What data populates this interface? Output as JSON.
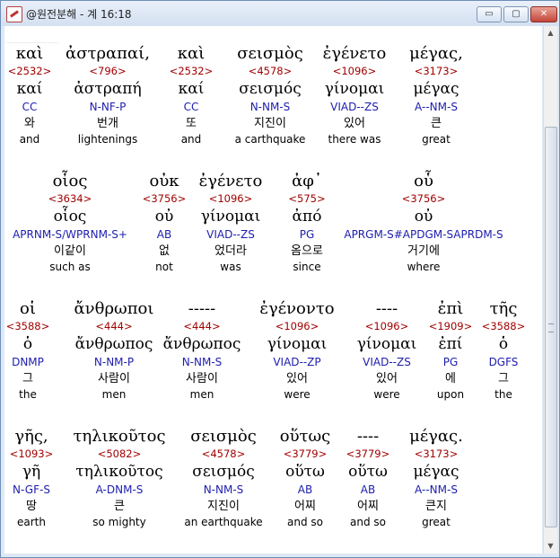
{
  "window": {
    "title": "@원전분해 - 계 16:18"
  },
  "buttons": {
    "minimize": "▭",
    "maximize": "▢",
    "close": "✕"
  },
  "lines": [
    {
      "words": [
        {
          "greek": "καὶ",
          "strong": "<2532>",
          "lemma": "καί",
          "morph": "CC",
          "korean": "와",
          "english": "and"
        },
        {
          "greek": "ἀστραπαί,",
          "strong": "<796>",
          "lemma": "ἀστραπή",
          "morph": "N-NF-P",
          "korean": "번개",
          "english": "lightenings"
        },
        {
          "greek": "καὶ",
          "strong": "<2532>",
          "lemma": "καί",
          "morph": "CC",
          "korean": "또",
          "english": "and"
        },
        {
          "greek": "σεισμὸς",
          "strong": "<4578>",
          "lemma": "σεισμός",
          "morph": "N-NM-S",
          "korean": "지진이",
          "english": "a carthquake"
        },
        {
          "greek": "ἐγένετο",
          "strong": "<1096>",
          "lemma": "γίνομαι",
          "morph": "VIAD--ZS",
          "korean": "있어",
          "english": "there was"
        },
        {
          "greek": "μέγας,",
          "strong": "<3173>",
          "lemma": "μέγας",
          "morph": "A--NM-S",
          "korean": "큰",
          "english": "great"
        }
      ]
    },
    {
      "words": [
        {
          "greek": "οἷος",
          "strong": "<3634>",
          "lemma": "οἷος",
          "morph": "APRNM-S/WPRNM-S+",
          "korean": "이같이",
          "english": "such as"
        },
        {
          "greek": "οὐκ",
          "strong": "<3756>",
          "lemma": "οὐ",
          "morph": "AB",
          "korean": "없",
          "english": "not"
        },
        {
          "greek": "ἐγένετο",
          "strong": "<1096>",
          "lemma": "γίνομαι",
          "morph": "VIAD--ZS",
          "korean": "었더라",
          "english": "was"
        },
        {
          "greek": "ἀφ᾽",
          "strong": "<575>",
          "lemma": "ἀπό",
          "morph": "PG",
          "korean": "옴으로",
          "english": "since"
        },
        {
          "greek": "οὗ",
          "strong": "<3756>",
          "lemma": "οὐ",
          "morph": "APRGM-S#APDGM-SAPRDM-S",
          "korean": "거기에",
          "english": "where"
        }
      ]
    },
    {
      "words": [
        {
          "greek": "οἱ",
          "strong": "<3588>",
          "lemma": "ὁ",
          "morph": "DNMP",
          "korean": "그",
          "english": "the"
        },
        {
          "greek": "ἄνθρωποι",
          "strong": "<444>",
          "lemma": "ἄνθρωπος",
          "morph": "N-NM-P",
          "korean": "사람이",
          "english": "men"
        },
        {
          "greek": "-----",
          "strong": "<444>",
          "lemma": "ἄνθρωπος",
          "morph": "N-NM-S",
          "korean": "사람이",
          "english": "men"
        },
        {
          "greek": "ἐγένοντο",
          "strong": "<1096>",
          "lemma": "γίνομαι",
          "morph": "VIAD--ZP",
          "korean": "있어",
          "english": "were"
        },
        {
          "greek": "----",
          "strong": "<1096>",
          "lemma": "γίνομαι",
          "morph": "VIAD--ZS",
          "korean": "있어",
          "english": "were"
        },
        {
          "greek": "ἐπὶ",
          "strong": "<1909>",
          "lemma": "ἐπί",
          "morph": "PG",
          "korean": "에",
          "english": "upon"
        },
        {
          "greek": "τῆς",
          "strong": "<3588>",
          "lemma": "ὁ",
          "morph": "DGFS",
          "korean": "그",
          "english": "the"
        }
      ]
    },
    {
      "words": [
        {
          "greek": "γῆς,",
          "strong": "<1093>",
          "lemma": "γῆ",
          "morph": "N-GF-S",
          "korean": "땅",
          "english": "earth"
        },
        {
          "greek": "τηλικοῦτος",
          "strong": "<5082>",
          "lemma": "τηλικοῦτος",
          "morph": "A-DNM-S",
          "korean": "큰",
          "english": "so mighty"
        },
        {
          "greek": "σεισμὸς",
          "strong": "<4578>",
          "lemma": "σεισμός",
          "morph": "N-NM-S",
          "korean": "지진이",
          "english": "an earthquake"
        },
        {
          "greek": "οὕτως",
          "strong": "<3779>",
          "lemma": "οὕτω",
          "morph": "AB",
          "korean": "어찌",
          "english": "and so"
        },
        {
          "greek": "----",
          "strong": "<3779>",
          "lemma": "οὕτω",
          "morph": "AB",
          "korean": "어찌",
          "english": "and so"
        },
        {
          "greek": "μέγας.",
          "strong": "<3173>",
          "lemma": "μέγας",
          "morph": "A--NM-S",
          "korean": "큰지",
          "english": "great"
        }
      ]
    }
  ]
}
